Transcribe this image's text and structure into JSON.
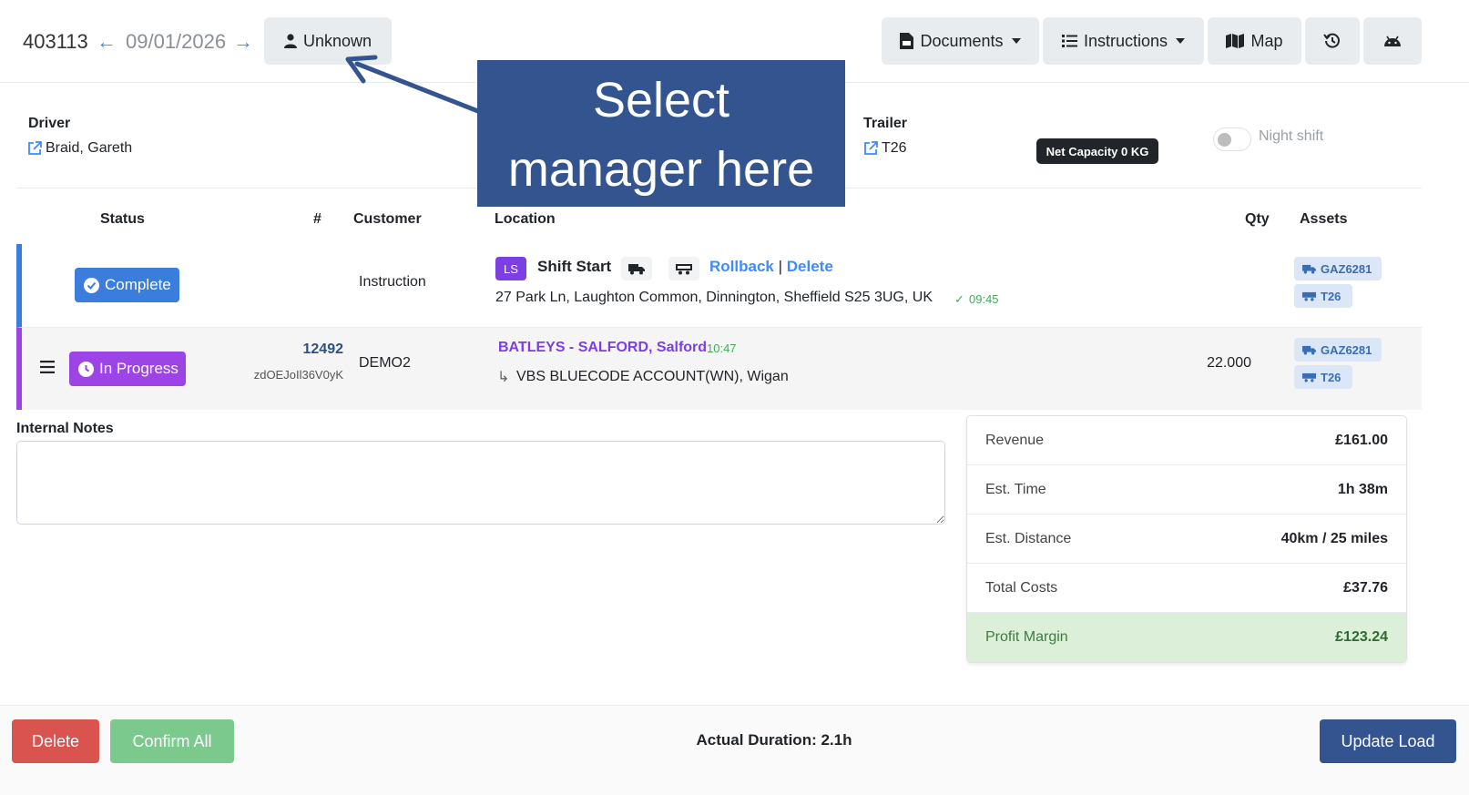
{
  "header": {
    "load_id": "403113",
    "prev_arrow": "←",
    "date": "09/01/2026",
    "next_arrow": "→",
    "manager_label": "Unknown",
    "documents_label": "Documents",
    "instructions_label": "Instructions",
    "map_label": "Map",
    "history_icon": "history-icon",
    "android_icon": "android-icon"
  },
  "driver": {
    "label": "Driver",
    "name": "Braid, Gareth"
  },
  "trailer": {
    "label": "Trailer",
    "name": "T26"
  },
  "net_capacity": "Net Capacity 0 KG",
  "night_shift": {
    "label": "Night shift",
    "enabled": false
  },
  "callout": {
    "line1": "Select",
    "line2": "manager here"
  },
  "table": {
    "headers": {
      "status": "Status",
      "number": "#",
      "customer": "Customer",
      "location": "Location",
      "qty": "Qty",
      "assets": "Assets"
    },
    "rows": [
      {
        "status": "Complete",
        "customer": "Instruction",
        "tag": "LS",
        "title": "Shift Start",
        "rollback": "Rollback",
        "divider": "|",
        "delete": "Delete",
        "address": "27 Park Ln, Laughton Common, Dinnington, Sheffield S25 3UG, UK",
        "check": "✓",
        "time": "09:45",
        "assets": [
          "GAZ6281",
          "T26"
        ]
      },
      {
        "status": "In Progress",
        "number": "12492",
        "ref": "zdOEJoIl36V0yK",
        "customer": "DEMO2",
        "title": "BATLEYS - SALFORD, Salford",
        "time": "10:47",
        "sub_arrow": "↳",
        "sub_location": "VBS BLUECODE ACCOUNT(WN), Wigan",
        "qty": "22.000",
        "assets": [
          "GAZ6281",
          "T26"
        ]
      }
    ]
  },
  "notes": {
    "label": "Internal Notes",
    "value": ""
  },
  "summary": [
    {
      "key": "Revenue",
      "value": "£161.00"
    },
    {
      "key": "Est. Time",
      "value": "1h 38m"
    },
    {
      "key": "Est. Distance",
      "value": "40km / 25 miles"
    },
    {
      "key": "Total Costs",
      "value": "£37.76"
    },
    {
      "key": "Profit Margin",
      "value": "£123.24"
    }
  ],
  "footer": {
    "delete_label": "Delete",
    "confirm_label": "Confirm All",
    "duration": "Actual Duration: 2.1h",
    "update_label": "Update Load"
  },
  "colors": {
    "primary": "#3b7ddd",
    "in_progress": "#9c44e6",
    "danger": "#d9534f",
    "success_light": "#7bc98d",
    "update_btn": "#34548f",
    "callout_bg": "#34548f"
  }
}
